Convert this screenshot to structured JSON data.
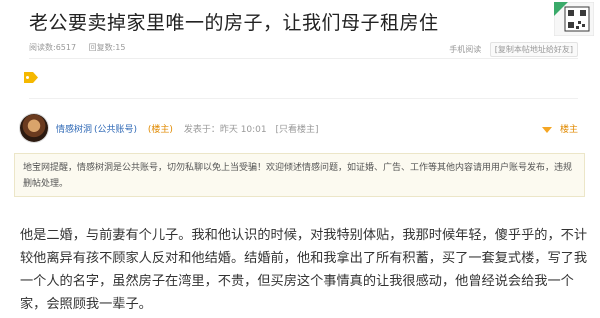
{
  "post": {
    "title": "老公要卖掉家里唯一的房子，让我们母子租房住",
    "reads": "阅读数:6517",
    "replies": "回复数:15",
    "mobile_read": "手机阅读",
    "copy_link": "[复制本帖地址给好友]"
  },
  "author": {
    "name": "情感树洞",
    "official": "(公共账号)",
    "host_badge": "(楼主)",
    "time": "发表于：昨天 10:01",
    "only_host": "[只看楼主]",
    "host_label": "楼主"
  },
  "notice": {
    "text": "地宝网提醒，情感树洞是公共账号，切勿私聊以免上当受骗！欢迎倾述情感问题，如证婚、广告、工作等其他内容请用用户账号发布，违规删帖处理。"
  },
  "content": {
    "paragraph": "他是二婚，与前妻有个儿子。我和他认识的时候，对我特别体贴，我那时候年轻，傻乎乎的，不计较他离异有孩不顾家人反对和他结婚。结婚前，他和我拿出了所有积蓄，买了一套复式楼，写了我一个人的名字，虽然房子在湾里，不贵，但买房这个事情真的让我很感动，他曾经说会给我一个家，会照顾我一辈子。"
  },
  "icons": {
    "qr": "qr-code-icon",
    "tag": "tag-icon",
    "caret": "caret-down-icon"
  },
  "colors": {
    "link": "#2f69b6",
    "host": "#e08a00",
    "tag": "#f5b800"
  }
}
